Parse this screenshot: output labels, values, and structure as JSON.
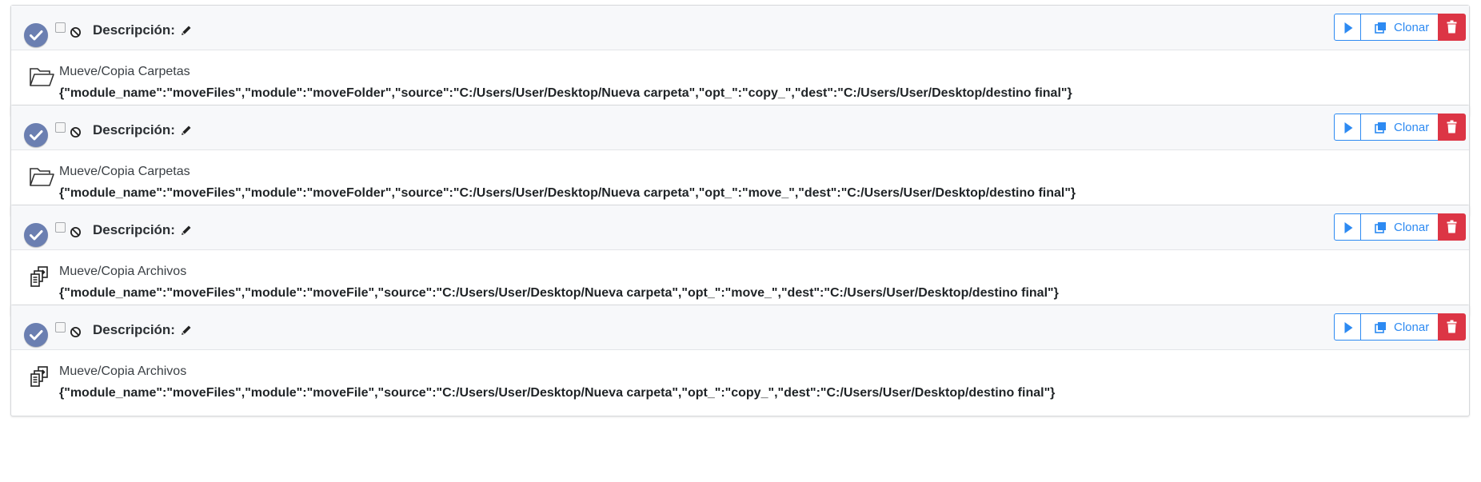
{
  "tasks": [
    {
      "description_label": "Descripción:",
      "clone_label": "Clonar",
      "module_title": "Mueve/Copia Carpetas",
      "module_icon": "folder-icon",
      "params": "{\"module_name\":\"moveFiles\",\"module\":\"moveFolder\",\"source\":\"C:/Users/User/Desktop/Nueva carpeta\",\"opt_\":\"copy_\",\"dest\":\"C:/Users/User/Desktop/destino final\"}"
    },
    {
      "description_label": "Descripción:",
      "clone_label": "Clonar",
      "module_title": "Mueve/Copia Carpetas",
      "module_icon": "folder-icon",
      "params": "{\"module_name\":\"moveFiles\",\"module\":\"moveFolder\",\"source\":\"C:/Users/User/Desktop/Nueva carpeta\",\"opt_\":\"move_\",\"dest\":\"C:/Users/User/Desktop/destino final\"}"
    },
    {
      "description_label": "Descripción:",
      "clone_label": "Clonar",
      "module_title": "Mueve/Copia Archivos",
      "module_icon": "files-move-icon",
      "params": "{\"module_name\":\"moveFiles\",\"module\":\"moveFile\",\"source\":\"C:/Users/User/Desktop/Nueva carpeta\",\"opt_\":\"move_\",\"dest\":\"C:/Users/User/Desktop/destino final\"}"
    },
    {
      "description_label": "Descripción:",
      "clone_label": "Clonar",
      "module_title": "Mueve/Copia Archivos",
      "module_icon": "files-move-icon",
      "params": "{\"module_name\":\"moveFiles\",\"module\":\"moveFile\",\"source\":\"C:/Users/User/Desktop/Nueva carpeta\",\"opt_\":\"copy_\",\"dest\":\"C:/Users/User/Desktop/destino final\"}"
    }
  ],
  "colors": {
    "primary": "#2d8af2",
    "danger": "#dc3545",
    "check_bg": "#6b7fb1",
    "header_bg": "#f7f8fa"
  }
}
